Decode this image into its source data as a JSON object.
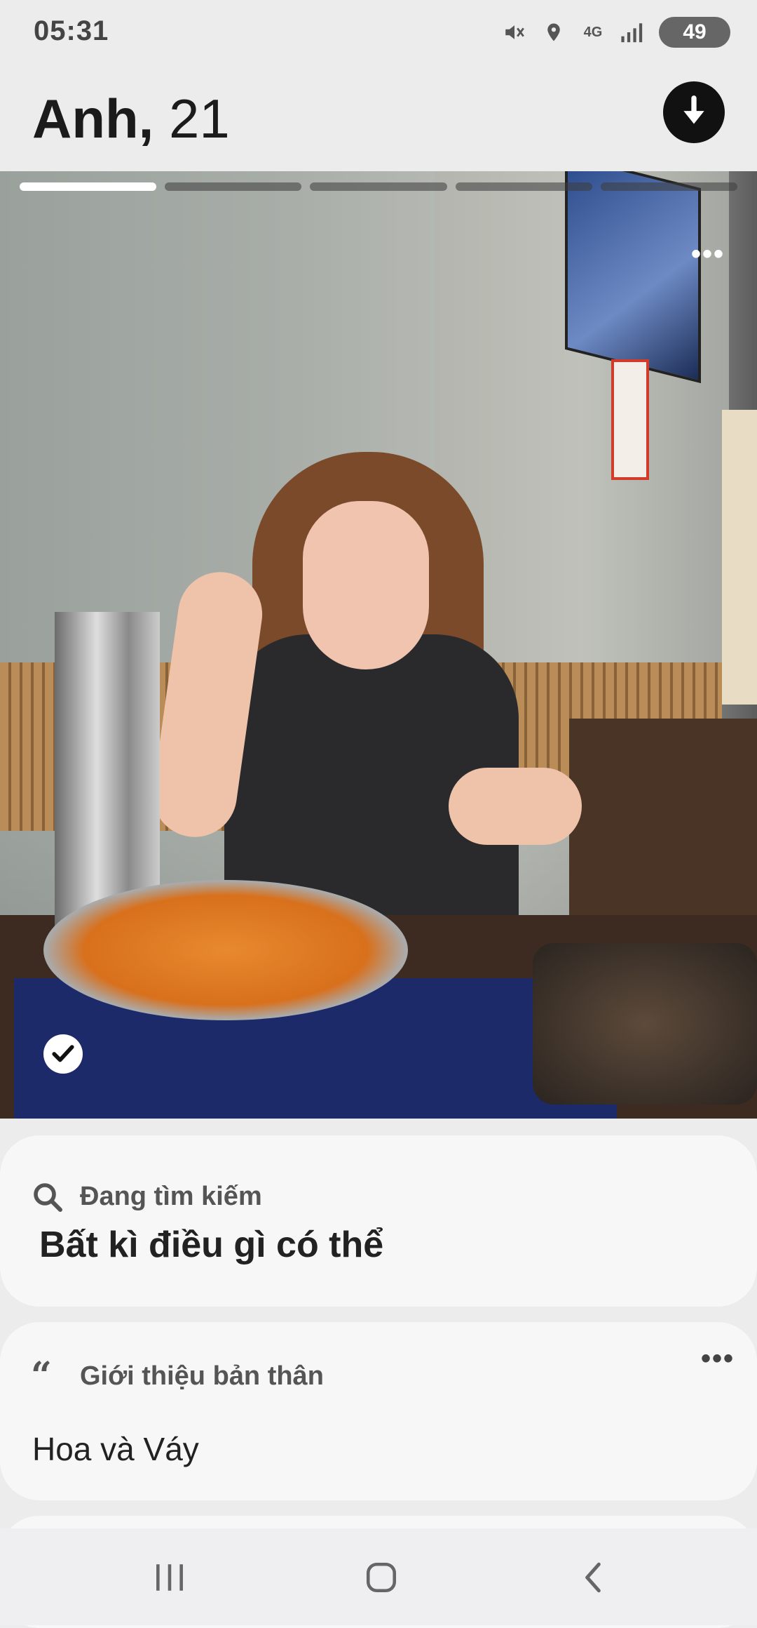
{
  "status_bar": {
    "time": "05:31",
    "network": "4G",
    "battery": "49"
  },
  "profile": {
    "name": "Anh,",
    "age": "21"
  },
  "photo": {
    "count": 5,
    "active_index": 0
  },
  "looking_for": {
    "label": "Đang tìm kiếm",
    "value": "Bất kì điều gì có thể"
  },
  "about": {
    "label": "Giới thiệu bản thân",
    "quote_icon": "“",
    "value": "Hoa và Váy"
  },
  "icons": {
    "download": "arrow-down-icon",
    "search": "search-icon",
    "more": "more-icon",
    "check": "check-icon"
  },
  "colors": {
    "background": "#ececed",
    "card": "#f7f7f8",
    "dark": "#111111"
  }
}
